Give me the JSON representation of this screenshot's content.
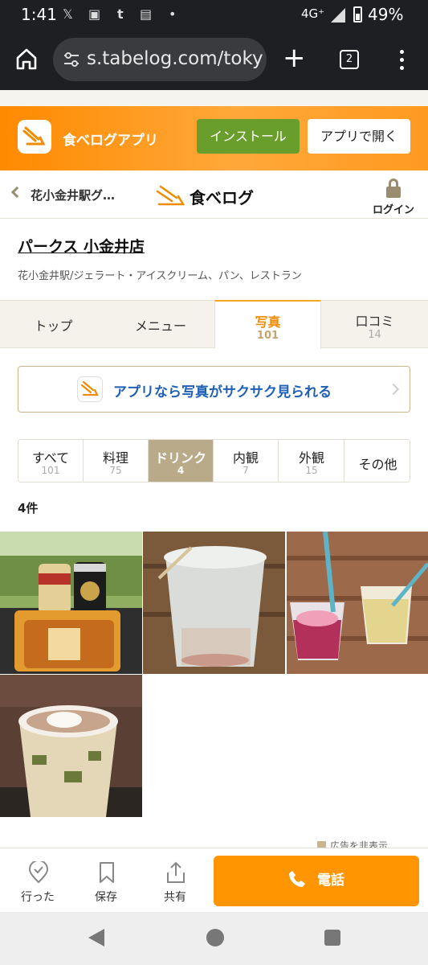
{
  "status_bar": {
    "time": "1:41",
    "network": "4G⁺",
    "battery": "49%",
    "battery_level": 0.49,
    "icons": [
      "x-icon",
      "screenshot-icon",
      "tumblr-icon",
      "photos-icon",
      "dot-icon"
    ]
  },
  "browser": {
    "url": "s.tabelog.com/toky",
    "tab_count": "2"
  },
  "app_banner": {
    "app_name": "食べログアプリ",
    "install_label": "インストール",
    "open_label": "アプリで開く"
  },
  "header": {
    "back_label": "花小金井駅グ…",
    "logo_text": "食べログ",
    "login_label": "ログイン"
  },
  "restaurant": {
    "name": "パークス 小金井店",
    "meta": "花小金井駅/ジェラート・アイスクリーム、パン、レストラン"
  },
  "tabs": [
    {
      "label": "トップ",
      "count": ""
    },
    {
      "label": "メニュー",
      "count": ""
    },
    {
      "label": "写真",
      "count": "101",
      "active": true
    },
    {
      "label": "口コミ",
      "count": "14"
    }
  ],
  "promo": {
    "text": "アプリなら写真がサクサク見られる"
  },
  "filters": [
    {
      "label": "すべて",
      "count": "101"
    },
    {
      "label": "料理",
      "count": "75"
    },
    {
      "label": "ドリンク",
      "count": "4",
      "active": true
    },
    {
      "label": "内観",
      "count": "7"
    },
    {
      "label": "外観",
      "count": "15"
    },
    {
      "label": "その他",
      "count": ""
    }
  ],
  "result_count": "4件",
  "ad_hide_label": "広告を非表示",
  "actions": {
    "went_label": "行った",
    "save_label": "保存",
    "share_label": "共有",
    "call_label": "電話"
  },
  "colors": {
    "brand_orange": "#ff9500",
    "install_green": "#6a9e2c",
    "active_tab": "#f08c00",
    "active_filter": "#b9aa8a",
    "promo_blue": "#1f5fb4"
  }
}
